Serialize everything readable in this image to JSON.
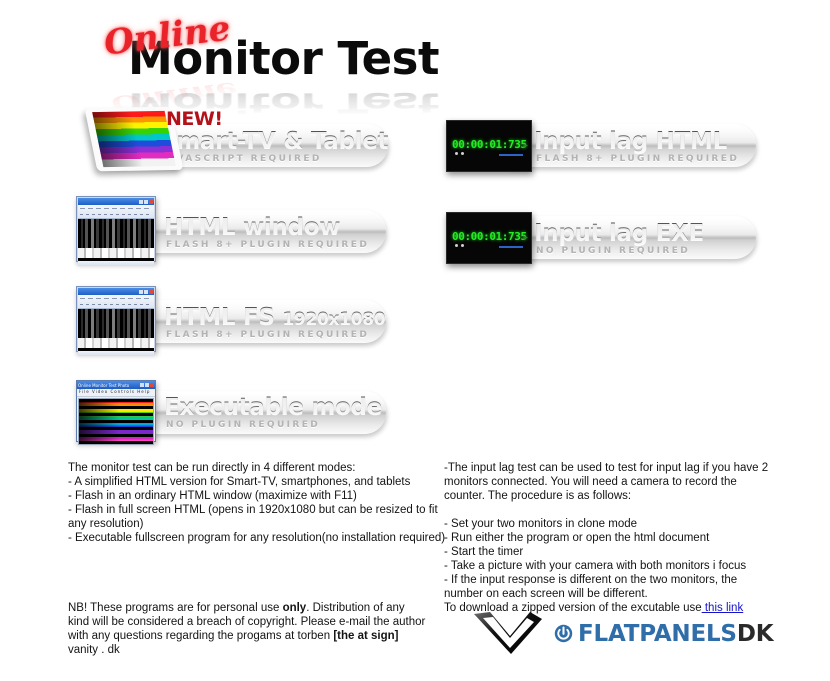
{
  "page": {
    "title_script": "Online",
    "title_main": "Monitor Test"
  },
  "modes": [
    {
      "id": "smart-tv-tablet",
      "badge": "NEW!",
      "label": "Smart-TV & Tablet",
      "requirement": "JAVASCRIPT REQUIRED",
      "thumb": "tablet-rainbow-thumbnail"
    },
    {
      "id": "html-window",
      "label": "HTML window",
      "requirement": "FLASH 8+ PLUGIN REQUIRED",
      "thumb": "browser-window-thumbnail"
    },
    {
      "id": "html-fs",
      "label": "HTML FS",
      "resolution": "1920x1080",
      "requirement": "FLASH 8+ PLUGIN REQUIRED",
      "thumb": "browser-window-thumbnail"
    },
    {
      "id": "executable-mode",
      "label": "Executable mode",
      "requirement": "NO PLUGIN REQUIRED",
      "thumb": "executable-window-thumbnail"
    },
    {
      "id": "input-lag-html",
      "label": "Input lag HTML",
      "requirement": "FLASH 8+ PLUGIN REQUIRED",
      "thumb": "timer-thumbnail",
      "timer": "00:00:01:735"
    },
    {
      "id": "input-lag-exe",
      "label": "Input lag EXE",
      "requirement": "NO PLUGIN REQUIRED",
      "thumb": "timer-thumbnail",
      "timer": "00:00:01:735"
    }
  ],
  "left_text": {
    "intro": "The monitor test can be run directly in 4 different modes:",
    "lines": [
      "- A simplified HTML version for Smart-TV, smartphones, and tablets",
      "- Flash in an ordinary HTML window (maximize with F11)",
      "- Flash in full screen HTML (opens in 1920x1080 but can be resized to fit any resolution)",
      "- Executable fullscreen program for any resolution(no installation required)"
    ]
  },
  "right_text": {
    "intro": "-The input lag test can be used to test for input lag if you have 2 monitors connected. You will need a camera to record the counter. The procedure is as follows:",
    "lines": [
      "- Set your two monitors in clone mode",
      "- Run either the program or open the html document",
      "- Start the timer",
      "- Take a picture with your camera with both monitors i focus",
      "- If the input response is different on the two monitors, the number on each screen will be different."
    ],
    "download_prefix": "To download a zipped version of the excutable use",
    "download_link": " this link"
  },
  "notice": {
    "part1": "NB! These programs are for personal use ",
    "bold1": "only",
    "part2": ". Distribution of any kind will be considered a breach of copyright. Please e-mail the author with any questions regarding the progams at torben ",
    "bold2": "[the at sign]",
    "part3": " vanity . dk"
  },
  "logo": {
    "brand_main": "FLATPANELS",
    "brand_suffix": "DK",
    "accent_color": "#2f6ea8"
  }
}
